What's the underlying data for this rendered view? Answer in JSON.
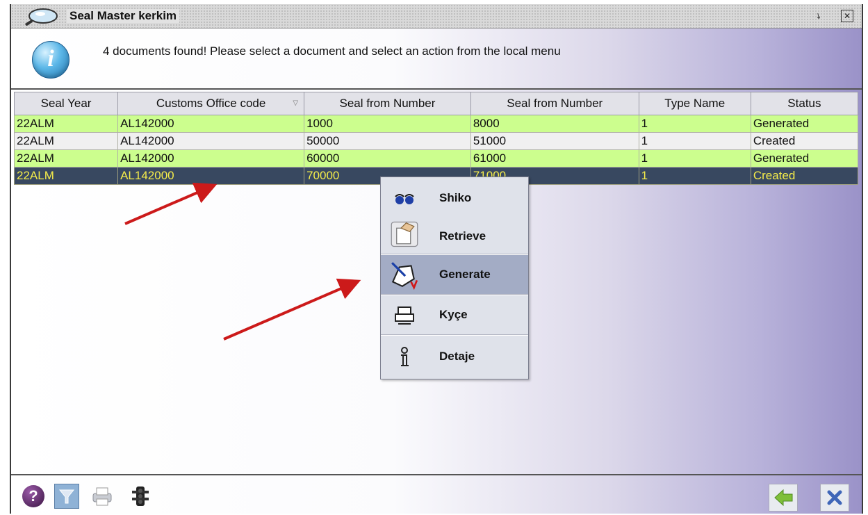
{
  "window": {
    "title": "Seal Master kerkim"
  },
  "info": {
    "message": "4 documents found! Please select a document and select an action from the local menu"
  },
  "table": {
    "columns": [
      "Seal Year",
      "Customs Office code",
      "Seal from Number",
      "Seal from Number",
      "Type Name",
      "Status"
    ],
    "rows": [
      [
        "22ALM",
        "AL142000",
        "1000",
        "8000",
        "1",
        "Generated"
      ],
      [
        "22ALM",
        "AL142000",
        "50000",
        "51000",
        "1",
        "Created"
      ],
      [
        "22ALM",
        "AL142000",
        "60000",
        "61000",
        "1",
        "Generated"
      ],
      [
        "22ALM",
        "AL142000",
        "70000",
        "71000",
        "1",
        "Created"
      ]
    ]
  },
  "context_menu": {
    "items": [
      {
        "label": "Shiko",
        "icon": "glasses-icon"
      },
      {
        "label": "Retrieve",
        "icon": "retrieve-hand-icon"
      },
      {
        "label": "Generate",
        "icon": "generate-pen-icon"
      },
      {
        "label": "Kyçe",
        "icon": "print-icon"
      },
      {
        "label": "Detaje",
        "icon": "info-i-icon"
      }
    ],
    "highlighted": "Generate"
  },
  "colors": {
    "row_green": "#ccfe8e",
    "row_selected_bg": "#384860",
    "row_selected_text": "#f5ec4a",
    "annotation_arrow": "#cc1a1a"
  }
}
